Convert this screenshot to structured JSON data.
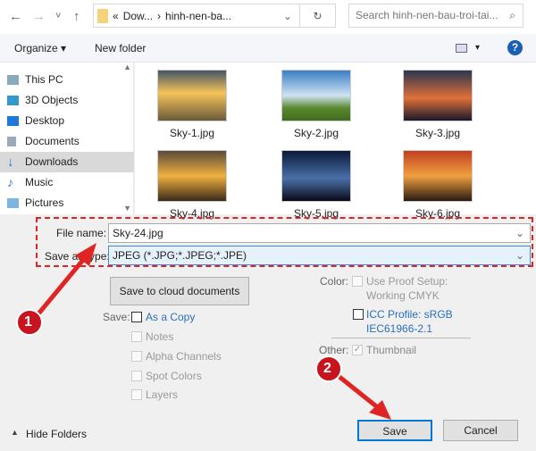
{
  "nav": {
    "back": "←",
    "forward": "→",
    "recent": "˅",
    "up": "↑",
    "breadcrumb_prefix": "«",
    "crumb1": "Dow...",
    "sep": "›",
    "crumb2": "hinh-nen-ba...",
    "refresh": "↻",
    "search_placeholder": "Search hinh-nen-bau-troi-tai...",
    "search_icon": "⌕"
  },
  "toolbar": {
    "organize": "Organize ▾",
    "new_folder": "New folder",
    "view": "▾",
    "help": "?"
  },
  "sidebar": {
    "items": [
      {
        "label": "This PC",
        "icon": "pc-icon"
      },
      {
        "label": "3D Objects",
        "icon": "cube-icon"
      },
      {
        "label": "Desktop",
        "icon": "desktop-icon"
      },
      {
        "label": "Documents",
        "icon": "documents-icon"
      },
      {
        "label": "Downloads",
        "icon": "download-icon",
        "selected": true
      },
      {
        "label": "Music",
        "icon": "music-icon"
      },
      {
        "label": "Pictures",
        "icon": "pictures-icon"
      }
    ]
  },
  "files": [
    {
      "name": "Sky-1.jpg"
    },
    {
      "name": "Sky-2.jpg"
    },
    {
      "name": "Sky-3.jpg"
    },
    {
      "name": "Sky-4.jpg"
    },
    {
      "name": "Sky-5.jpg"
    },
    {
      "name": "Sky-6.jpg"
    }
  ],
  "form": {
    "file_name_label": "File name:",
    "file_name": "Sky-24.jpg",
    "type_label": "Save as type:",
    "type_value": "JPEG (*.JPG;*.JPEG;*.JPE)",
    "chev": "⌄",
    "cloud": "Save to cloud documents",
    "save_label": "Save:",
    "as_copy": "As a Copy",
    "notes": "Notes",
    "alpha": "Alpha Channels",
    "spot": "Spot Colors",
    "layers": "Layers",
    "color_label": "Color:",
    "proof1": "Use Proof Setup:",
    "proof2": "Working CMYK",
    "icc1": "ICC Profile:  sRGB",
    "icc2": "IEC61966-2.1",
    "other_label": "Other:",
    "thumbnail": "Thumbnail",
    "hide": "Hide Folders",
    "save": "Save",
    "cancel": "Cancel"
  },
  "annotations": {
    "step1": "1",
    "step2": "2",
    "color": "#e02424"
  }
}
